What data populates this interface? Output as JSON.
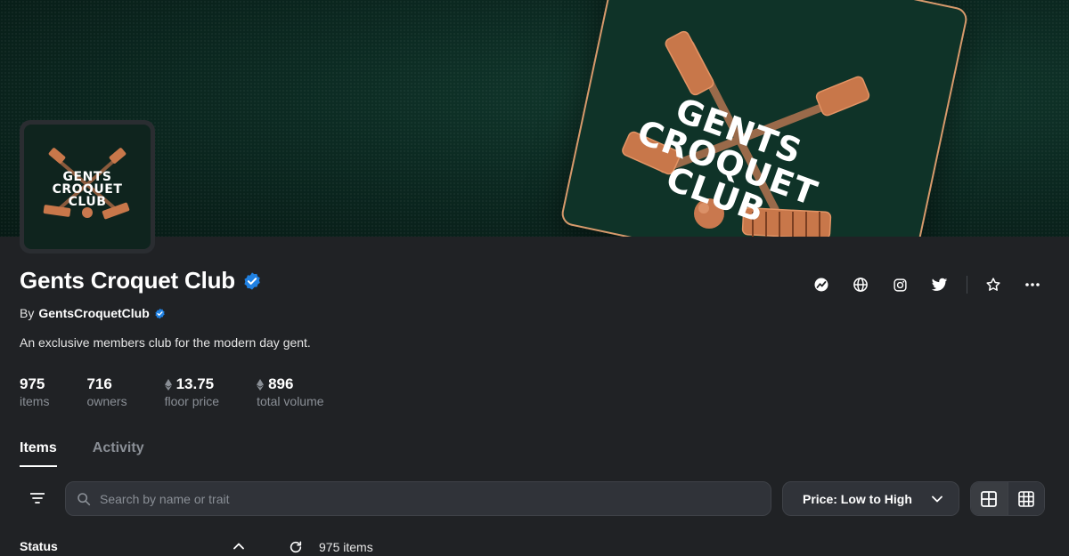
{
  "banner": {
    "title_lines": [
      "GENTS",
      "CROQUET",
      "CLUB"
    ],
    "accent_color": "#d79a6c",
    "background_color": "#0c2a22"
  },
  "avatar": {
    "title_lines": [
      "GENTS",
      "CROQUET",
      "CLUB"
    ]
  },
  "collection": {
    "title": "Gents Croquet Club",
    "by_label": "By",
    "creator": "GentsCroquetClub",
    "description": "An exclusive members club for the modern day gent.",
    "verified_color": "#2081e2"
  },
  "stats": [
    {
      "value": "975",
      "label": "items",
      "currency": false
    },
    {
      "value": "716",
      "label": "owners",
      "currency": false
    },
    {
      "value": "13.75",
      "label": "floor price",
      "currency": true
    },
    {
      "value": "896",
      "label": "total volume",
      "currency": true
    }
  ],
  "actions": {
    "icons": [
      "activity-icon",
      "globe-icon",
      "instagram-icon",
      "twitter-icon",
      "star-icon",
      "more-icon"
    ]
  },
  "tabs": [
    {
      "label": "Items",
      "active": true
    },
    {
      "label": "Activity",
      "active": false
    }
  ],
  "toolbar": {
    "search_placeholder": "Search by name or trait",
    "sort_label": "Price: Low to High",
    "view_modes": [
      "large-grid-icon",
      "small-grid-icon"
    ]
  },
  "sidebar": {
    "status_label": "Status"
  },
  "results": {
    "count_label": "975 items"
  }
}
